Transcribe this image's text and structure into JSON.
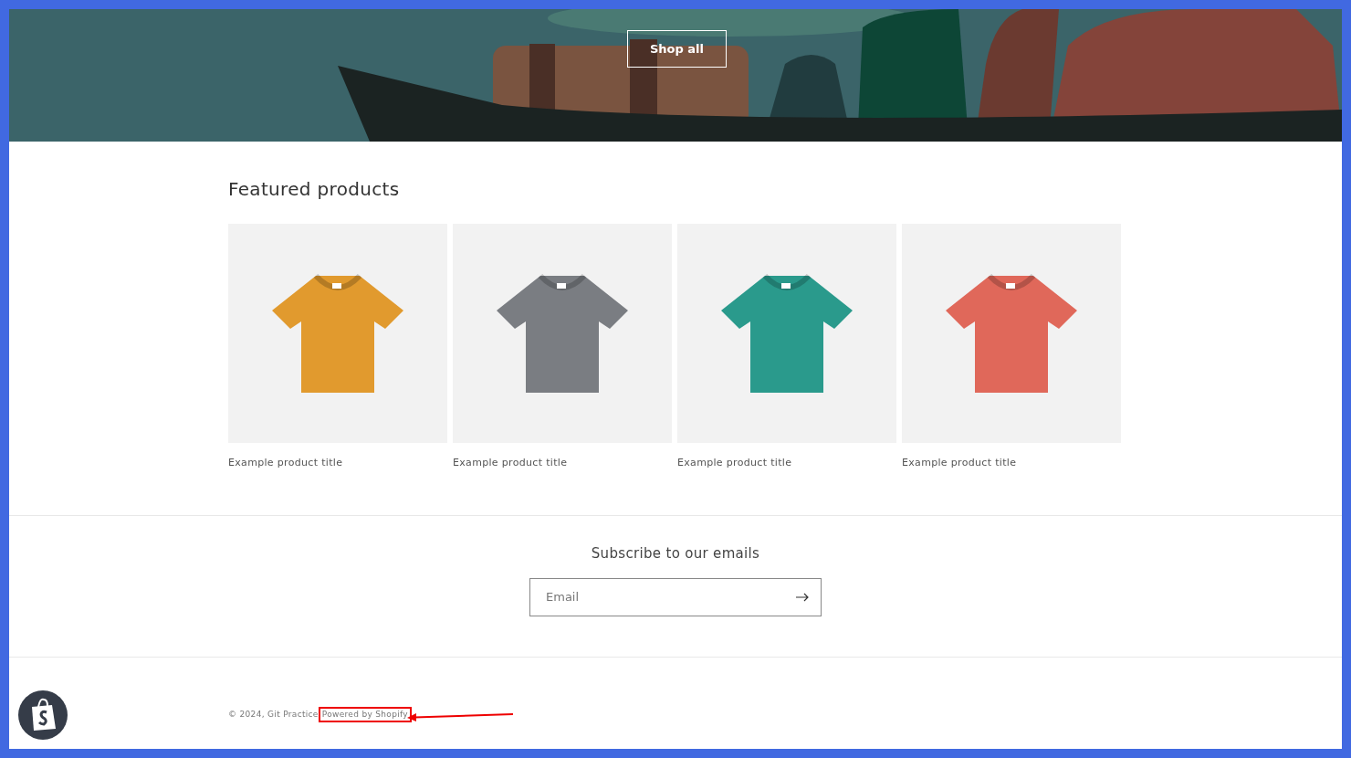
{
  "hero": {
    "button": "Shop all"
  },
  "featured": {
    "title": "Featured products",
    "products": [
      {
        "title": "Example product title",
        "color": "#e19a2e"
      },
      {
        "title": "Example product title",
        "color": "#7a7d82"
      },
      {
        "title": "Example product title",
        "color": "#2a9a8c"
      },
      {
        "title": "Example product title",
        "color": "#e0685a"
      }
    ]
  },
  "newsletter": {
    "title": "Subscribe to our emails",
    "placeholder": "Email"
  },
  "footer": {
    "copyright": "© 2024, Git Practice",
    "link": "Powered by Shopify"
  }
}
